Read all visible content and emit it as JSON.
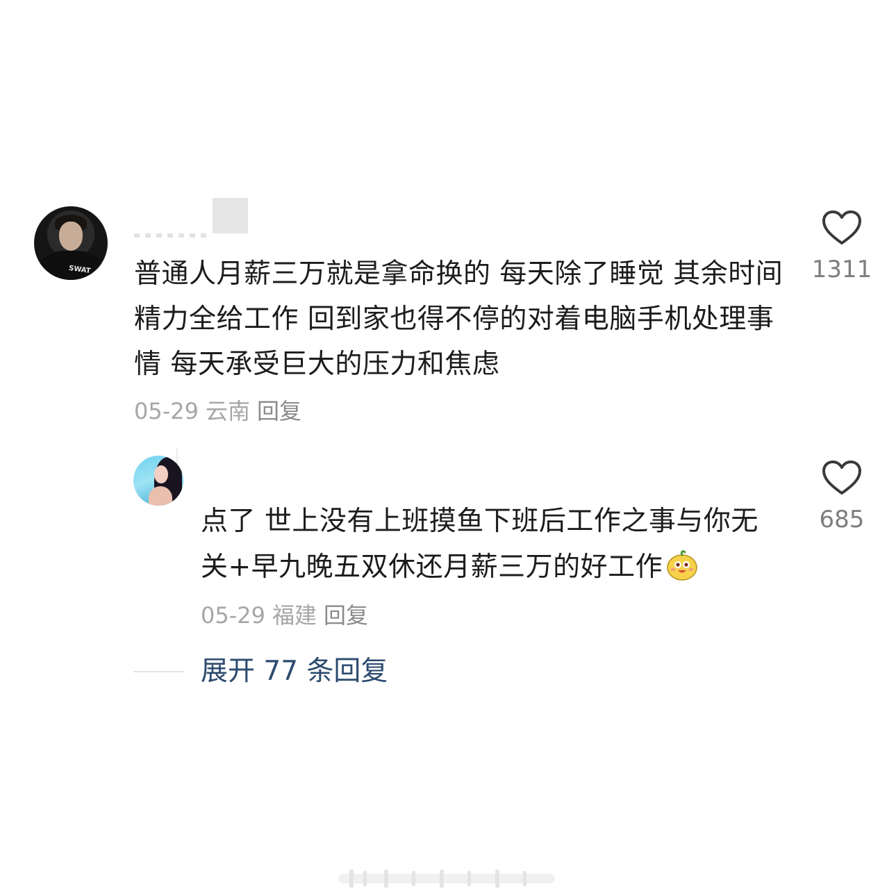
{
  "comments": [
    {
      "content": "普通人月薪三万就是拿命换的 每天除了睡觉 其余时间精力全给工作 回到家也得不停的对着电脑手机处理事情  每天承受巨大的压力和焦虑",
      "date": "05-29",
      "region": "云南",
      "reply_label": "回复",
      "likes": "1311"
    }
  ],
  "replies": [
    {
      "content": "点了  世上没有上班摸鱼下班后工作之事与你无关+早九晚五双休还月薪三万的好工作",
      "emoji_icon": "grinning-mascot-icon",
      "date": "05-29",
      "region": "福建",
      "reply_label": "回复",
      "likes": "685"
    }
  ],
  "expand_label": "展开 77 条回复",
  "colors": {
    "text": "#1c1c1c",
    "meta": "#a6a6a6",
    "link": "#2c4a6e",
    "like_icon": "#3a3a3a"
  }
}
